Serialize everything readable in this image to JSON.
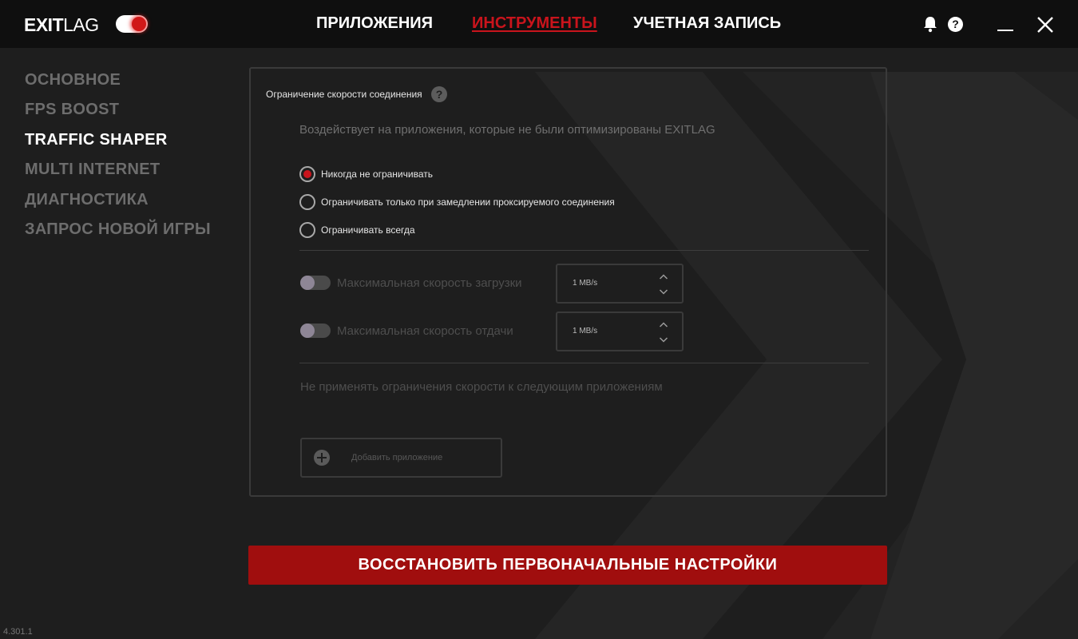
{
  "app": {
    "logo_exit": "EXIT",
    "logo_lag": "LAG",
    "version": "4.301.1",
    "power_on": true
  },
  "header": {
    "tabs": [
      {
        "label": "ПРИЛОЖЕНИЯ",
        "active": false
      },
      {
        "label": "ИНСТРУМЕНТЫ",
        "active": true
      },
      {
        "label": "УЧЕТНАЯ ЗАПИСЬ",
        "active": false
      }
    ],
    "icons": [
      "bell-icon",
      "help-icon",
      "minimize-icon",
      "close-icon"
    ],
    "help_glyph": "?"
  },
  "sidebar": {
    "items": [
      {
        "label": "ОСНОВНОЕ",
        "active": false
      },
      {
        "label": "FPS BOOST",
        "active": false
      },
      {
        "label": "TRAFFIC SHAPER",
        "active": true
      },
      {
        "label": "MULTI INTERNET",
        "active": false
      },
      {
        "label": "ДИАГНОСТИКА",
        "active": false
      },
      {
        "label": "ЗАПРОС НОВОЙ ИГРЫ",
        "active": false
      }
    ]
  },
  "panel": {
    "title": "Ограничение скорости соединения",
    "help_glyph": "?",
    "description": "Воздействует на приложения, которые не были оптимизированы EXITLAG",
    "options": [
      {
        "label": "Никогда не ограничивать",
        "selected": true
      },
      {
        "label": "Ограничивать только при замедлении проксируемого соединения",
        "selected": false
      },
      {
        "label": "Ограничивать всегда",
        "selected": false
      }
    ],
    "limits": [
      {
        "label": "Максимальная скорость загрузки",
        "value": "1 MB/s",
        "enabled": false
      },
      {
        "label": "Максимальная скорость отдачи",
        "value": "1 MB/s",
        "enabled": false
      }
    ],
    "exclude_label": "Не применять ограничения скорости к следующим приложениям",
    "add_app_label": "Добавить приложение"
  },
  "actions": {
    "reset_label": "ВОССТАНОВИТЬ ПЕРВОНАЧАЛЬНЫЕ НАСТРОЙКИ"
  },
  "colors": {
    "accent": "#c9141c",
    "button": "#a00e0e",
    "background": "#1e1e1e",
    "topbar": "#0f0f0f"
  }
}
